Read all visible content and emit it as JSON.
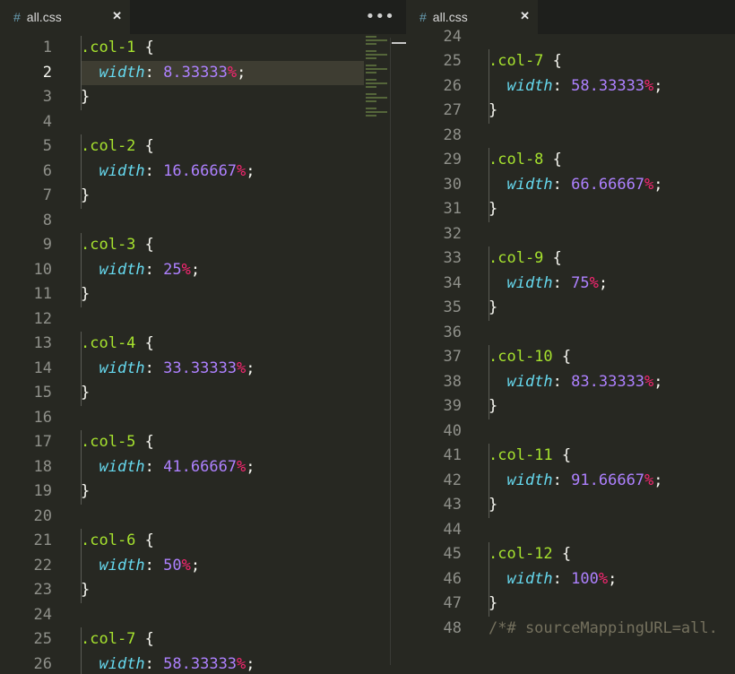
{
  "left_pane": {
    "tab": {
      "icon": "hash-icon",
      "icon_glyph": "#",
      "title": "all.css",
      "close_glyph": "✕"
    },
    "more_glyph": "•••",
    "first_line": 1,
    "active_line": 2,
    "lines": [
      [
        [
          "sel",
          ".col-1"
        ],
        [
          "punc",
          " {"
        ]
      ],
      [
        [
          "punc",
          "  "
        ],
        [
          "prop",
          "width"
        ],
        [
          "punc",
          ": "
        ],
        [
          "num",
          "8.33333"
        ],
        [
          "unit",
          "%"
        ],
        [
          "punc",
          ";"
        ]
      ],
      [
        [
          "punc",
          "}"
        ]
      ],
      [],
      [
        [
          "sel",
          ".col-2"
        ],
        [
          "punc",
          " {"
        ]
      ],
      [
        [
          "punc",
          "  "
        ],
        [
          "prop",
          "width"
        ],
        [
          "punc",
          ": "
        ],
        [
          "num",
          "16.66667"
        ],
        [
          "unit",
          "%"
        ],
        [
          "punc",
          ";"
        ]
      ],
      [
        [
          "punc",
          "}"
        ]
      ],
      [],
      [
        [
          "sel",
          ".col-3"
        ],
        [
          "punc",
          " {"
        ]
      ],
      [
        [
          "punc",
          "  "
        ],
        [
          "prop",
          "width"
        ],
        [
          "punc",
          ": "
        ],
        [
          "num",
          "25"
        ],
        [
          "unit",
          "%"
        ],
        [
          "punc",
          ";"
        ]
      ],
      [
        [
          "punc",
          "}"
        ]
      ],
      [],
      [
        [
          "sel",
          ".col-4"
        ],
        [
          "punc",
          " {"
        ]
      ],
      [
        [
          "punc",
          "  "
        ],
        [
          "prop",
          "width"
        ],
        [
          "punc",
          ": "
        ],
        [
          "num",
          "33.33333"
        ],
        [
          "unit",
          "%"
        ],
        [
          "punc",
          ";"
        ]
      ],
      [
        [
          "punc",
          "}"
        ]
      ],
      [],
      [
        [
          "sel",
          ".col-5"
        ],
        [
          "punc",
          " {"
        ]
      ],
      [
        [
          "punc",
          "  "
        ],
        [
          "prop",
          "width"
        ],
        [
          "punc",
          ": "
        ],
        [
          "num",
          "41.66667"
        ],
        [
          "unit",
          "%"
        ],
        [
          "punc",
          ";"
        ]
      ],
      [
        [
          "punc",
          "}"
        ]
      ],
      [],
      [
        [
          "sel",
          ".col-6"
        ],
        [
          "punc",
          " {"
        ]
      ],
      [
        [
          "punc",
          "  "
        ],
        [
          "prop",
          "width"
        ],
        [
          "punc",
          ": "
        ],
        [
          "num",
          "50"
        ],
        [
          "unit",
          "%"
        ],
        [
          "punc",
          ";"
        ]
      ],
      [
        [
          "punc",
          "}"
        ]
      ],
      [],
      [
        [
          "sel",
          ".col-7"
        ],
        [
          "punc",
          " {"
        ]
      ],
      [
        [
          "punc",
          "  "
        ],
        [
          "prop",
          "width"
        ],
        [
          "punc",
          ": "
        ],
        [
          "num",
          "58.33333"
        ],
        [
          "unit",
          "%"
        ],
        [
          "punc",
          ";"
        ]
      ]
    ]
  },
  "right_pane": {
    "tab": {
      "icon": "hash-icon",
      "icon_glyph": "#",
      "title": "all.css",
      "close_glyph": "✕"
    },
    "first_line": 24,
    "active_line": null,
    "lines": [
      [],
      [
        [
          "sel",
          ".col-7"
        ],
        [
          "punc",
          " {"
        ]
      ],
      [
        [
          "punc",
          "  "
        ],
        [
          "prop",
          "width"
        ],
        [
          "punc",
          ": "
        ],
        [
          "num",
          "58.33333"
        ],
        [
          "unit",
          "%"
        ],
        [
          "punc",
          ";"
        ]
      ],
      [
        [
          "punc",
          "}"
        ]
      ],
      [],
      [
        [
          "sel",
          ".col-8"
        ],
        [
          "punc",
          " {"
        ]
      ],
      [
        [
          "punc",
          "  "
        ],
        [
          "prop",
          "width"
        ],
        [
          "punc",
          ": "
        ],
        [
          "num",
          "66.66667"
        ],
        [
          "unit",
          "%"
        ],
        [
          "punc",
          ";"
        ]
      ],
      [
        [
          "punc",
          "}"
        ]
      ],
      [],
      [
        [
          "sel",
          ".col-9"
        ],
        [
          "punc",
          " {"
        ]
      ],
      [
        [
          "punc",
          "  "
        ],
        [
          "prop",
          "width"
        ],
        [
          "punc",
          ": "
        ],
        [
          "num",
          "75"
        ],
        [
          "unit",
          "%"
        ],
        [
          "punc",
          ";"
        ]
      ],
      [
        [
          "punc",
          "}"
        ]
      ],
      [],
      [
        [
          "sel",
          ".col-10"
        ],
        [
          "punc",
          " {"
        ]
      ],
      [
        [
          "punc",
          "  "
        ],
        [
          "prop",
          "width"
        ],
        [
          "punc",
          ": "
        ],
        [
          "num",
          "83.33333"
        ],
        [
          "unit",
          "%"
        ],
        [
          "punc",
          ";"
        ]
      ],
      [
        [
          "punc",
          "}"
        ]
      ],
      [],
      [
        [
          "sel",
          ".col-11"
        ],
        [
          "punc",
          " {"
        ]
      ],
      [
        [
          "punc",
          "  "
        ],
        [
          "prop",
          "width"
        ],
        [
          "punc",
          ": "
        ],
        [
          "num",
          "91.66667"
        ],
        [
          "unit",
          "%"
        ],
        [
          "punc",
          ";"
        ]
      ],
      [
        [
          "punc",
          "}"
        ]
      ],
      [],
      [
        [
          "sel",
          ".col-12"
        ],
        [
          "punc",
          " {"
        ]
      ],
      [
        [
          "punc",
          "  "
        ],
        [
          "prop",
          "width"
        ],
        [
          "punc",
          ": "
        ],
        [
          "num",
          "100"
        ],
        [
          "unit",
          "%"
        ],
        [
          "punc",
          ";"
        ]
      ],
      [
        [
          "punc",
          "}"
        ]
      ],
      [
        [
          "comment",
          "/*# sourceMappingURL=all."
        ]
      ]
    ]
  },
  "colors": {
    "background": "#272822",
    "selector": "#a6e22e",
    "property": "#66d9ef",
    "number": "#ae81ff",
    "unit": "#f92672",
    "comment": "#75715e"
  }
}
